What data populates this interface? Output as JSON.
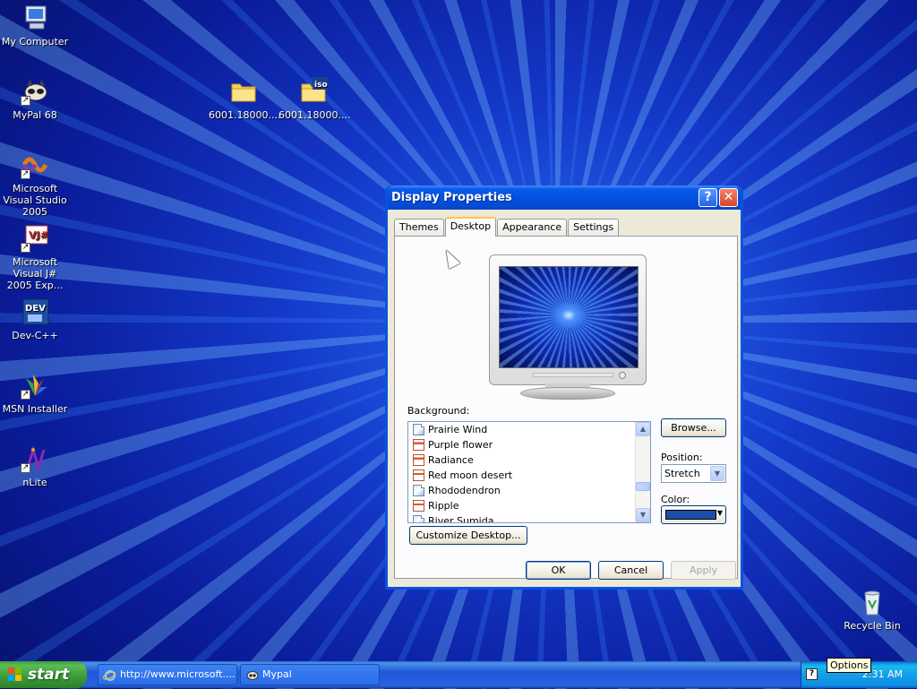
{
  "desktop": {
    "icons": [
      {
        "name": "my-computer-icon",
        "label": "My Computer"
      },
      {
        "name": "mypal-68-icon",
        "label": "MyPal 68"
      },
      {
        "name": "visual-studio-icon",
        "label": "Microsoft Visual Studio 2005"
      },
      {
        "name": "visual-jsharp-icon",
        "label": "Microsoft Visual J# 2005 Exp..."
      },
      {
        "name": "dev-cpp-icon",
        "label": "Dev-C++"
      },
      {
        "name": "msn-installer-icon",
        "label": "MSN Installer"
      },
      {
        "name": "nlite-icon",
        "label": "nLite"
      },
      {
        "name": "folder-icon",
        "label": "6001.18000...."
      },
      {
        "name": "iso-folder-icon",
        "label": "6001.18000...."
      },
      {
        "name": "recycle-bin-icon",
        "label": "Recycle Bin"
      }
    ]
  },
  "dialog": {
    "title": "Display Properties",
    "tabs": [
      "Themes",
      "Desktop",
      "Appearance",
      "Settings"
    ],
    "active_tab": "Desktop",
    "background_label": "Background:",
    "backgrounds": [
      "Prairie Wind",
      "Purple flower",
      "Radiance",
      "Red moon desert",
      "Rhododendron",
      "Ripple",
      "River Sumida"
    ],
    "browse_label": "Browse...",
    "position_label": "Position:",
    "position_value": "Stretch",
    "color_label": "Color:",
    "color_value": "#1a4fa8",
    "customize_label": "Customize Desktop...",
    "ok_label": "OK",
    "cancel_label": "Cancel",
    "apply_label": "Apply"
  },
  "taskbar": {
    "start_label": "start",
    "tasks": [
      "http://www.microsoft....",
      "Mypal"
    ],
    "clock": "2:31 AM",
    "tooltip": "Options"
  }
}
